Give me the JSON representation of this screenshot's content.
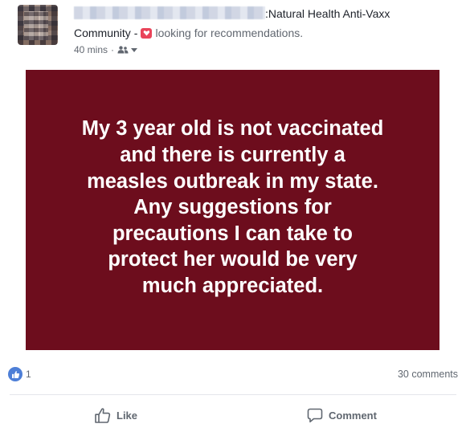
{
  "post": {
    "group_title_suffix": ":Natural Health Anti-Vaxx",
    "group_title_line2": "Community",
    "separator": "-",
    "feeling_text": "looking for recommendations.",
    "timestamp": "40 mins",
    "meta_separator": "·",
    "audience_icon": "group-icon",
    "content_lines": [
      "My 3 year old is not vaccinated",
      "and there is currently a",
      "measles outbreak in my state.",
      "Any suggestions for",
      "precautions I can take to",
      "protect her would be very",
      "much appreciated."
    ],
    "content_background": "#6d0d1d",
    "content_text_color": "#ffffff"
  },
  "reactions": {
    "like_count": "1",
    "comments_label": "30 comments",
    "like_badge_color": "#4e7fd7"
  },
  "actions": {
    "like_label": "Like",
    "comment_label": "Comment"
  }
}
